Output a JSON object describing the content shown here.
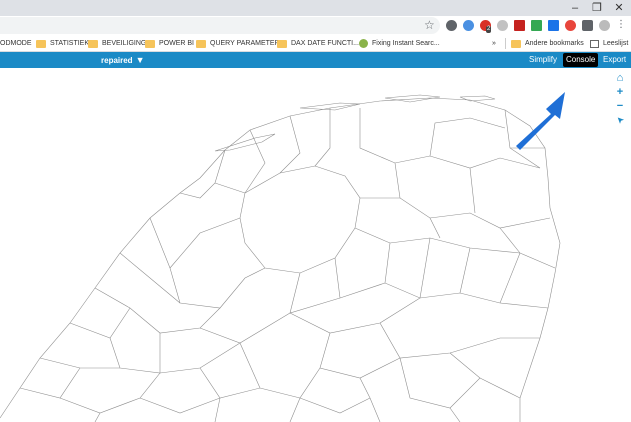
{
  "window": {
    "minimize_glyph": "–",
    "restore_glyph": "❐",
    "close_glyph": "✕"
  },
  "browser": {
    "bookmark_star_icon": "star-icon",
    "extension_badge": "2",
    "menu_glyph": "⋮"
  },
  "bookmarks": {
    "items": [
      {
        "label": "ODMODE",
        "icon": "none"
      },
      {
        "label": "STATISTIEK",
        "icon": "folder-icon"
      },
      {
        "label": "BEVEILIGING",
        "icon": "folder-icon"
      },
      {
        "label": "POWER BI",
        "icon": "folder-icon"
      },
      {
        "label": "QUERY PARAMETERS",
        "icon": "folder-icon"
      },
      {
        "label": "DAX DATE FUNCTI...",
        "icon": "folder-icon"
      },
      {
        "label": "Fixing Instant Searc...",
        "icon": "site-icon"
      }
    ],
    "overflow": "»",
    "other": "Andere bookmarks",
    "reading_list": "Leeslijst"
  },
  "app": {
    "dataset_name": "repaired",
    "dataset_caret": "▼",
    "buttons": {
      "simplify": "Simplify",
      "console": "Console",
      "export": "Export"
    },
    "accent_color": "#1b8ac6"
  },
  "map_tools": [
    {
      "name": "home-icon",
      "glyph": "⌂"
    },
    {
      "name": "zoom-in-icon",
      "glyph": "+"
    },
    {
      "name": "zoom-out-icon",
      "glyph": "−"
    },
    {
      "name": "pointer-icon",
      "glyph": "➤"
    }
  ],
  "annotation": {
    "arrow_color": "#1f6fd6"
  }
}
